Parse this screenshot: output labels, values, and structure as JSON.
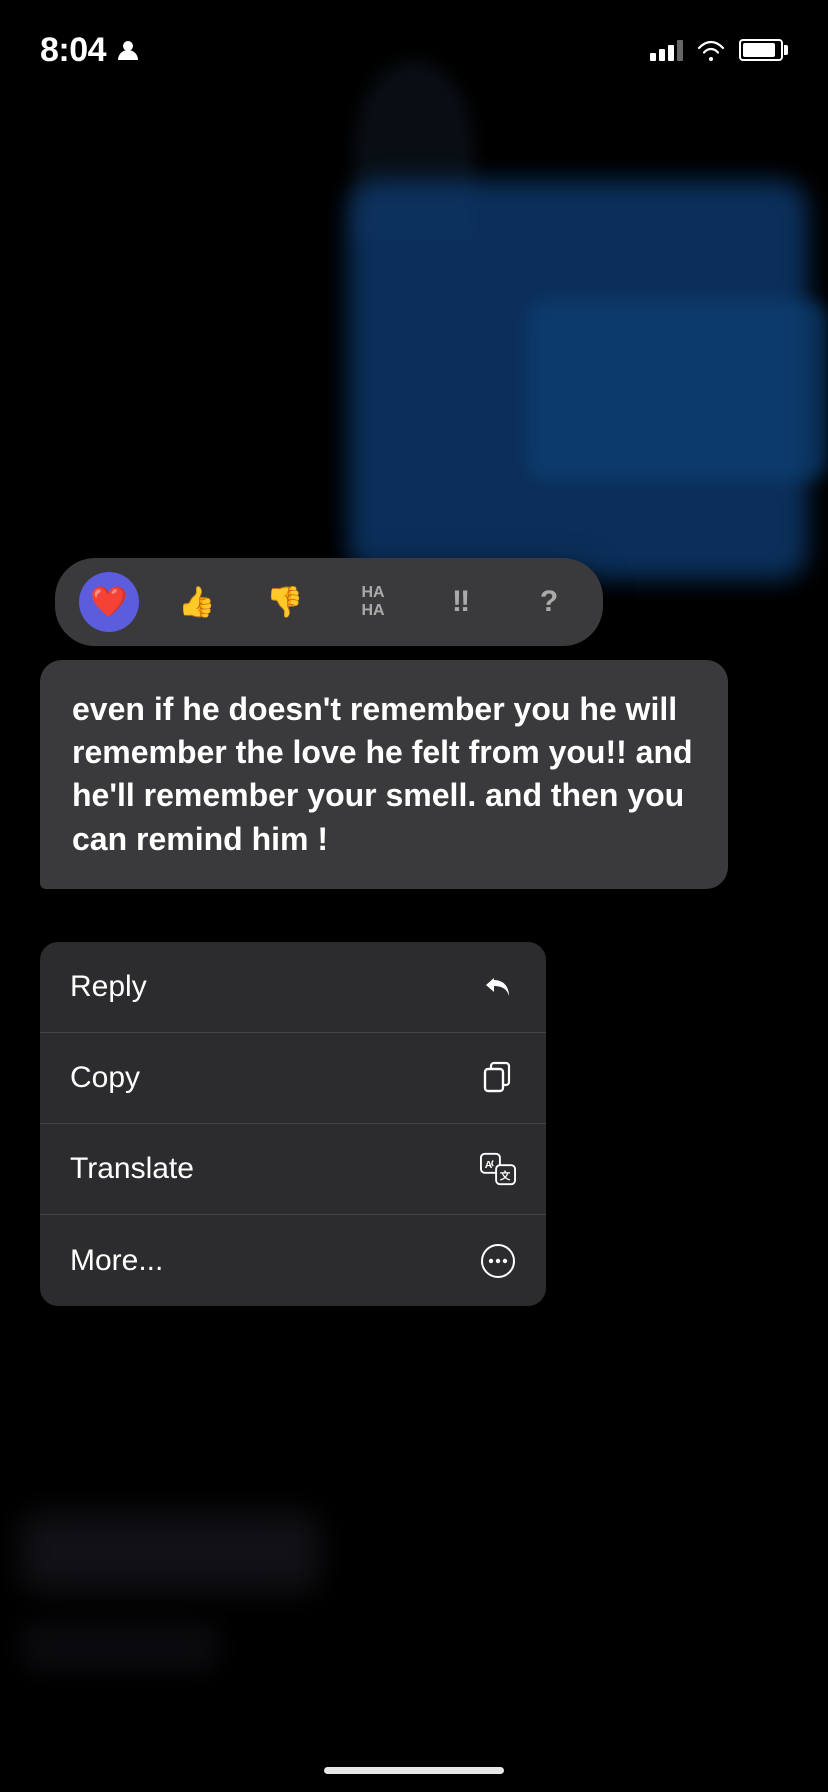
{
  "statusBar": {
    "time": "8:04",
    "personIcon": "👤"
  },
  "reactionBar": {
    "reactions": [
      {
        "id": "heart",
        "emoji": "❤️",
        "active": true
      },
      {
        "id": "thumbsup",
        "emoji": "👍",
        "active": false
      },
      {
        "id": "thumbsdown",
        "emoji": "👎",
        "active": false
      },
      {
        "id": "haha",
        "label": "HA\nHA",
        "active": false
      },
      {
        "id": "exclaim",
        "emoji": "‼",
        "active": false
      },
      {
        "id": "question",
        "emoji": "?",
        "active": false
      }
    ]
  },
  "messageBubble": {
    "text": "even if he doesn't remember you he will remember the love he felt from you!! and he'll remember your smell. and then you can remind him !"
  },
  "contextMenu": {
    "items": [
      {
        "id": "reply",
        "label": "Reply",
        "icon": "reply"
      },
      {
        "id": "copy",
        "label": "Copy",
        "icon": "copy"
      },
      {
        "id": "translate",
        "label": "Translate",
        "icon": "translate"
      },
      {
        "id": "more",
        "label": "More...",
        "icon": "more"
      }
    ]
  }
}
